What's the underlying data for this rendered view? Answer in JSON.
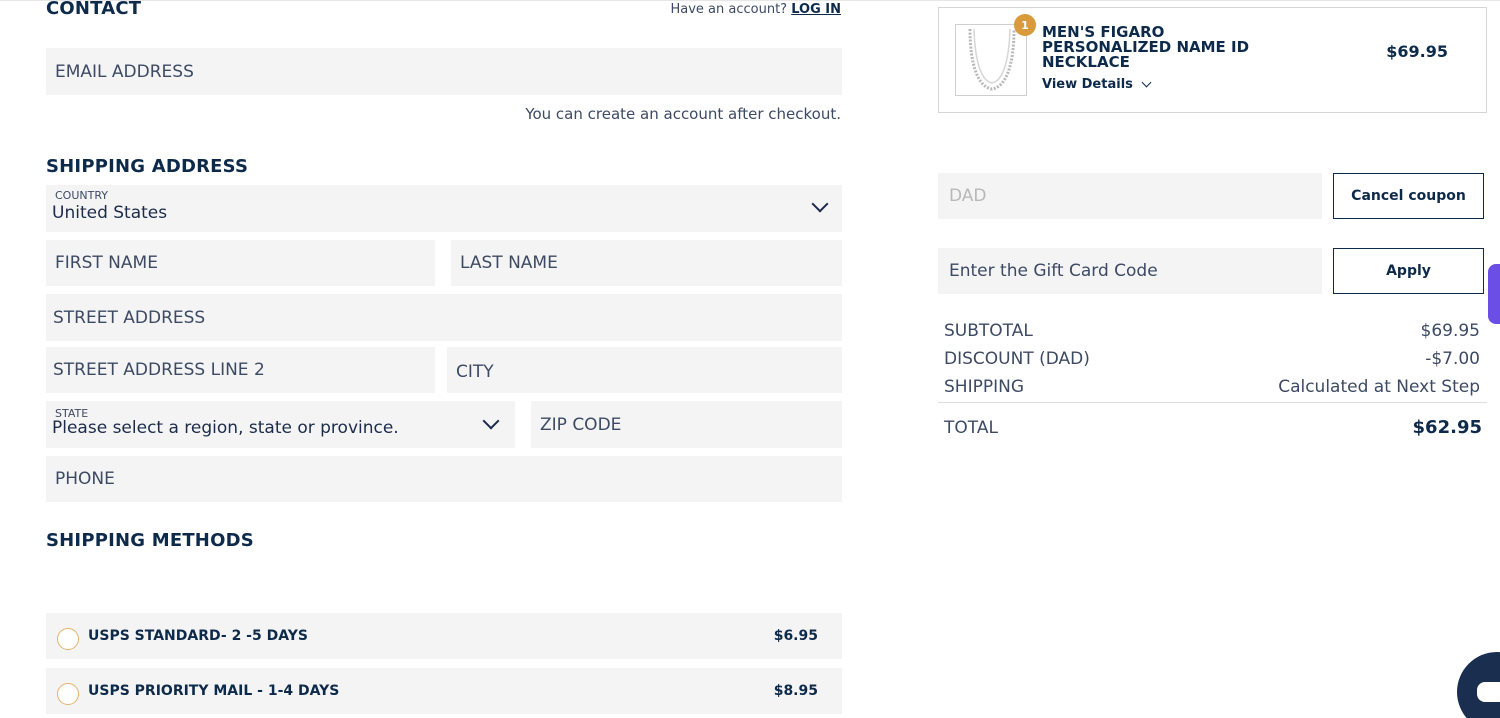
{
  "contact": {
    "heading": "CONTACT",
    "have_account": "Have an account?",
    "login_link": "LOG IN",
    "email_placeholder": "EMAIL ADDRESS",
    "create_account_note": "You can create an account after checkout."
  },
  "shipping_address": {
    "heading": "SHIPPING ADDRESS",
    "country_label": "COUNTRY",
    "country_value": "United States",
    "first_name_placeholder": "FIRST NAME",
    "last_name_placeholder": "LAST NAME",
    "street_placeholder": "STREET ADDRESS",
    "street2_placeholder": "STREET ADDRESS LINE 2",
    "city_placeholder": "CITY",
    "state_label": "STATE",
    "state_value": "Please select a region, state or province.",
    "zip_placeholder": "ZIP CODE",
    "phone_placeholder": "PHONE"
  },
  "shipping_methods": {
    "heading": "SHIPPING METHODS",
    "options": [
      {
        "label": "USPS STANDARD- 2 -5 DAYS",
        "price": "$6.95"
      },
      {
        "label": "USPS PRIORITY MAIL - 1-4 DAYS",
        "price": "$8.95"
      }
    ]
  },
  "cart": {
    "item": {
      "quantity": "1",
      "name_line1": "MEN'S FIGARO",
      "name_line2": "PERSONALIZED NAME ID",
      "name_line3": "NECKLACE",
      "price": "$69.95",
      "view_details": "View Details"
    }
  },
  "coupon": {
    "value": "DAD",
    "cancel_label": "Cancel coupon"
  },
  "gift_card": {
    "placeholder": "Enter the Gift Card Code",
    "apply_label": "Apply"
  },
  "summary": {
    "subtotal_label": "SUBTOTAL",
    "subtotal_value": "$69.95",
    "discount_label": "DISCOUNT (DAD)",
    "discount_value": "-$7.00",
    "shipping_label": "SHIPPING",
    "shipping_value": "Calculated at Next Step",
    "total_label": "TOTAL",
    "total_value": "$62.95"
  },
  "colors": {
    "navy": "#0e2a4a",
    "field_bg": "#f4f4f4",
    "badge": "#d99a3c",
    "radio_border": "#e3b36b",
    "chat_widget": "#1a2e4f",
    "side_tab": "#6b4ee6"
  }
}
